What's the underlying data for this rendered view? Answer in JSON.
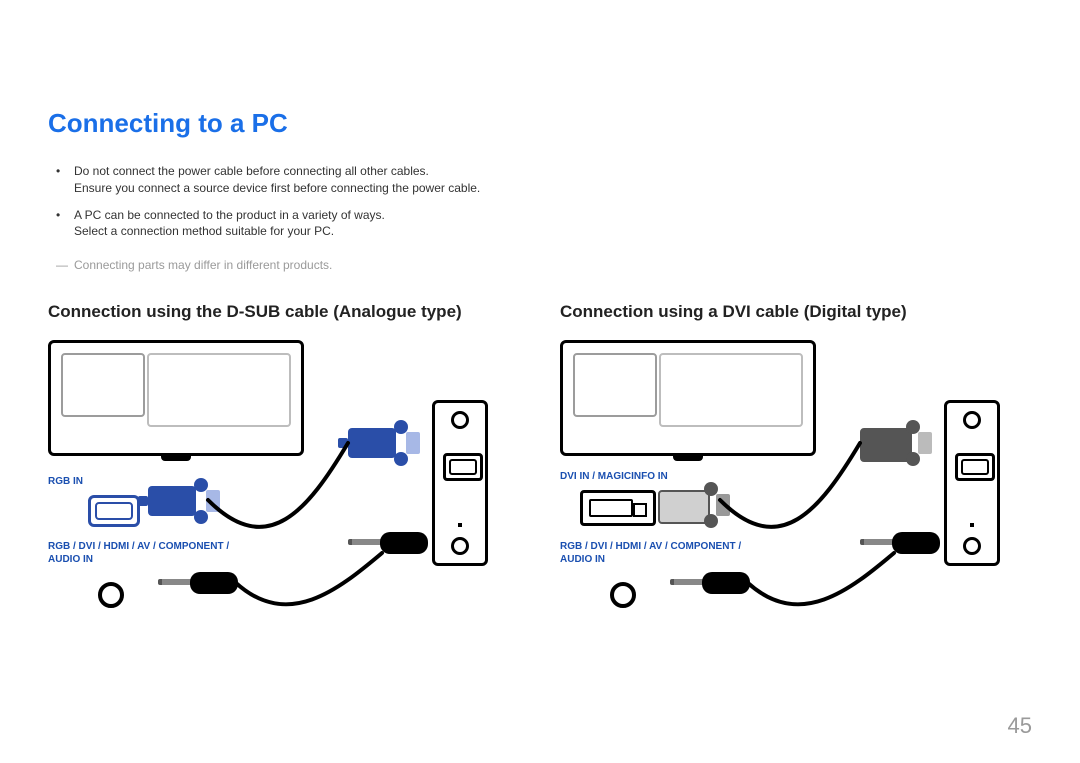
{
  "title": "Connecting to a PC",
  "notes": [
    {
      "main": "Do not connect the power cable before connecting all other cables.",
      "sub": "Ensure you connect a source device first before connecting the power cable."
    },
    {
      "main": "A PC can be connected to the product in a variety of ways.",
      "sub": "Select a connection method suitable for your PC."
    }
  ],
  "footnote": "Connecting parts may differ in different products.",
  "left": {
    "heading": "Connection using the D-SUB cable (Analogue type)",
    "label_rgb": "RGB IN",
    "label_audio": "RGB / DVI / HDMI / AV / COMPONENT / AUDIO IN"
  },
  "right": {
    "heading": "Connection using a DVI cable (Digital type)",
    "label_dvi": "DVI IN / MAGICINFO IN",
    "label_audio": "RGB / DVI / HDMI / AV / COMPONENT / AUDIO IN"
  },
  "pagenum": "45"
}
